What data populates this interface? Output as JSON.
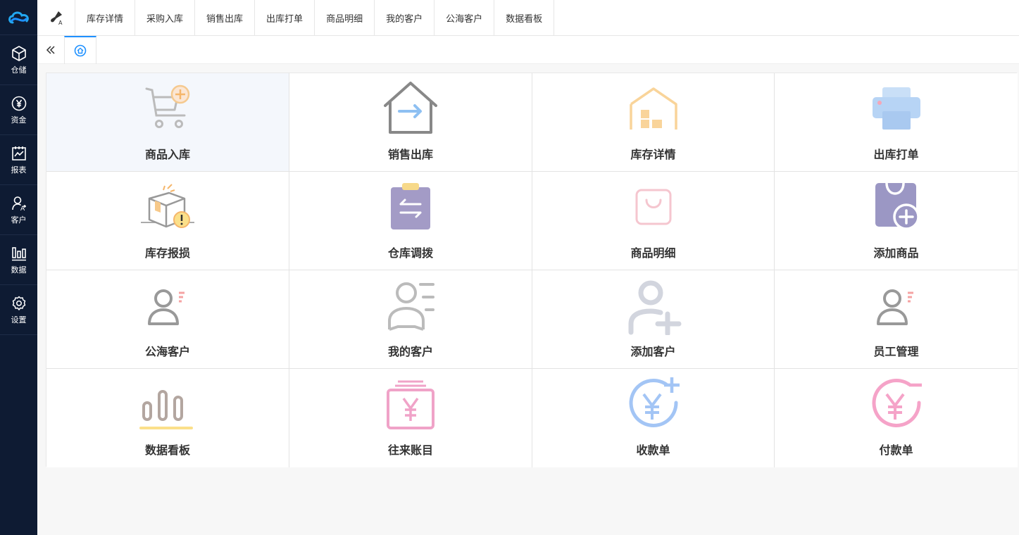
{
  "top_tabs": [
    "库存详情",
    "采购入库",
    "销售出库",
    "出库打单",
    "商品明细",
    "我的客户",
    "公海客户",
    "数据看板"
  ],
  "sidebar": [
    {
      "label": "仓储",
      "icon": "box-icon"
    },
    {
      "label": "资金",
      "icon": "yen-icon"
    },
    {
      "label": "报表",
      "icon": "report-icon"
    },
    {
      "label": "客户",
      "icon": "customer-icon"
    },
    {
      "label": "数据",
      "icon": "bar-chart-icon"
    },
    {
      "label": "设置",
      "icon": "gear-icon"
    }
  ],
  "tiles": [
    {
      "label": "商品入库",
      "icon": "cart-add-icon"
    },
    {
      "label": "销售出库",
      "icon": "house-out-icon"
    },
    {
      "label": "库存详情",
      "icon": "warehouse-icon"
    },
    {
      "label": "出库打单",
      "icon": "printer-icon"
    },
    {
      "label": "库存报损",
      "icon": "damaged-box-icon"
    },
    {
      "label": "仓库调拨",
      "icon": "clipboard-transfer-icon"
    },
    {
      "label": "商品明细",
      "icon": "bag-icon"
    },
    {
      "label": "添加商品",
      "icon": "bag-add-icon"
    },
    {
      "label": "公海客户",
      "icon": "user-list-icon"
    },
    {
      "label": "我的客户",
      "icon": "user-lines-icon"
    },
    {
      "label": "添加客户",
      "icon": "user-add-icon"
    },
    {
      "label": "员工管理",
      "icon": "staff-icon"
    },
    {
      "label": "数据看板",
      "icon": "bars-icon"
    },
    {
      "label": "往来账目",
      "icon": "ledger-yen-icon"
    },
    {
      "label": "收款单",
      "icon": "yen-plus-icon"
    },
    {
      "label": "付款单",
      "icon": "yen-minus-icon"
    }
  ],
  "colors": {
    "sidebar_bg": "#0e1b33",
    "accent": "#1e90ff"
  }
}
